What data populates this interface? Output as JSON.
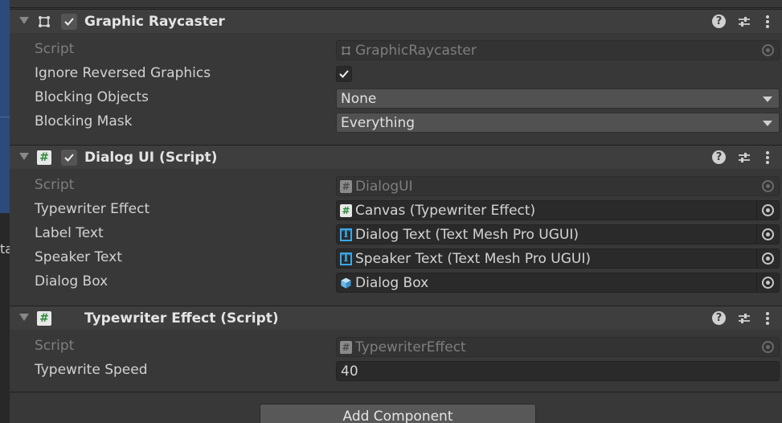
{
  "left_fragment": "ta",
  "components": {
    "graphic_raycaster": {
      "title": "Graphic Raycaster",
      "script_label": "Script",
      "script_value": "GraphicRaycaster",
      "ignore_reversed_label": "Ignore Reversed Graphics",
      "ignore_reversed_checked": true,
      "blocking_objects_label": "Blocking Objects",
      "blocking_objects_value": "None",
      "blocking_mask_label": "Blocking Mask",
      "blocking_mask_value": "Everything"
    },
    "dialog_ui": {
      "title": "Dialog UI (Script)",
      "script_label": "Script",
      "script_value": "DialogUI",
      "typewriter_effect_label": "Typewriter Effect",
      "typewriter_effect_value": "Canvas (Typewriter Effect)",
      "label_text_label": "Label Text",
      "label_text_value": "Dialog Text (Text Mesh Pro UGUI)",
      "speaker_text_label": "Speaker Text",
      "speaker_text_value": "Speaker Text (Text Mesh Pro UGUI)",
      "dialog_box_label": "Dialog Box",
      "dialog_box_value": "Dialog Box"
    },
    "typewriter_effect": {
      "title": "Typewriter Effect (Script)",
      "script_label": "Script",
      "script_value": "TypewriterEffect",
      "speed_label": "Typewrite Speed",
      "speed_value": "40"
    }
  },
  "help_glyph": "?",
  "add_component_label": "Add Component",
  "icons": {
    "rect_transform": "rect-transform-icon",
    "script": "script-hash-icon",
    "tmp": "text-mesh-pro-icon",
    "gameobject": "cube-icon",
    "help": "help-icon",
    "preset": "preset-sliders-icon",
    "menu": "kebab-menu-icon",
    "picker": "object-picker-icon"
  },
  "colors": {
    "background": "#383838",
    "header": "#3e3e3e",
    "field": "#2a2a2a",
    "dropdown": "#515151",
    "tmp_accent": "#3aa8e8",
    "script_green": "#2a8a3a"
  }
}
